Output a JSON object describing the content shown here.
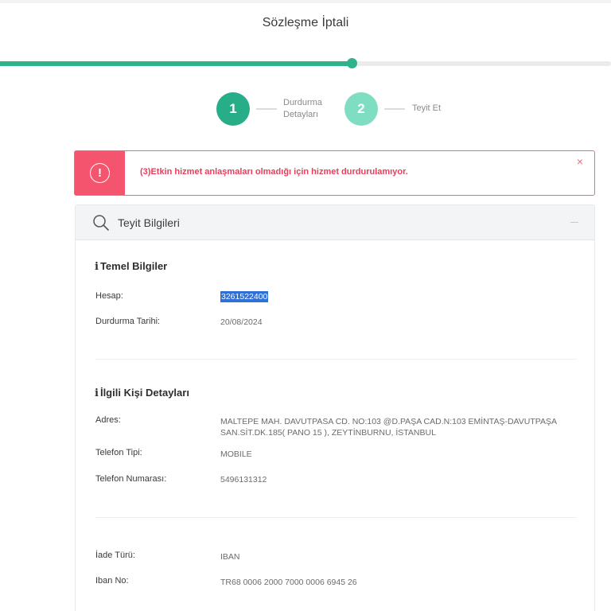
{
  "title": "Sözleşme İptali",
  "progress": {
    "percent": 57.5
  },
  "steps": [
    {
      "number": "1",
      "label_line1": "Durdurma",
      "label_line2": "Detayları"
    },
    {
      "number": "2",
      "label": "Teyit Et"
    }
  ],
  "alert": {
    "icon": "exclamation-icon",
    "message": "(3)Etkin hizmet anlaşmaları olmadığı için hizmet durdurulamıyor.",
    "close": "×",
    "color": "#f4546d"
  },
  "card": {
    "title": "Teyit Bilgileri",
    "collapse": "—",
    "sections": {
      "basic": {
        "icon": "i",
        "title": "Temel Bilgiler",
        "fields": [
          {
            "label": "Hesap:",
            "value": "3261522400"
          },
          {
            "label": "Durdurma Tarihi:",
            "value": "20/08/2024"
          }
        ]
      },
      "contact": {
        "icon": "i",
        "title": "İlgili Kişi Detayları",
        "fields": [
          {
            "label": "Adres:",
            "value_line1": "MALTEPE MAH. DAVUTPASA CD. NO:103 @D.PAŞA CAD.N:103 EMİNTAŞ-DAVUTPAŞA",
            "value_line2": "SAN.SİT.DK.185( PANO 15 ), ZEYTİNBURNU, İSTANBUL"
          },
          {
            "label": "Telefon Tipi:",
            "value": "MOBILE"
          },
          {
            "label": "Telefon Numarası:",
            "value": "5496131312"
          }
        ]
      },
      "refund": {
        "fields": [
          {
            "label": "İade Türü:",
            "value": "IBAN"
          },
          {
            "label": "Iban No:",
            "value": "TR68 0006 2000 7000 0006 6945 26"
          }
        ]
      }
    }
  },
  "colors": {
    "primary": "#27ad87",
    "primary_light": "#7fdec2",
    "danger": "#f4546d",
    "selection": "#2f6fd8"
  }
}
